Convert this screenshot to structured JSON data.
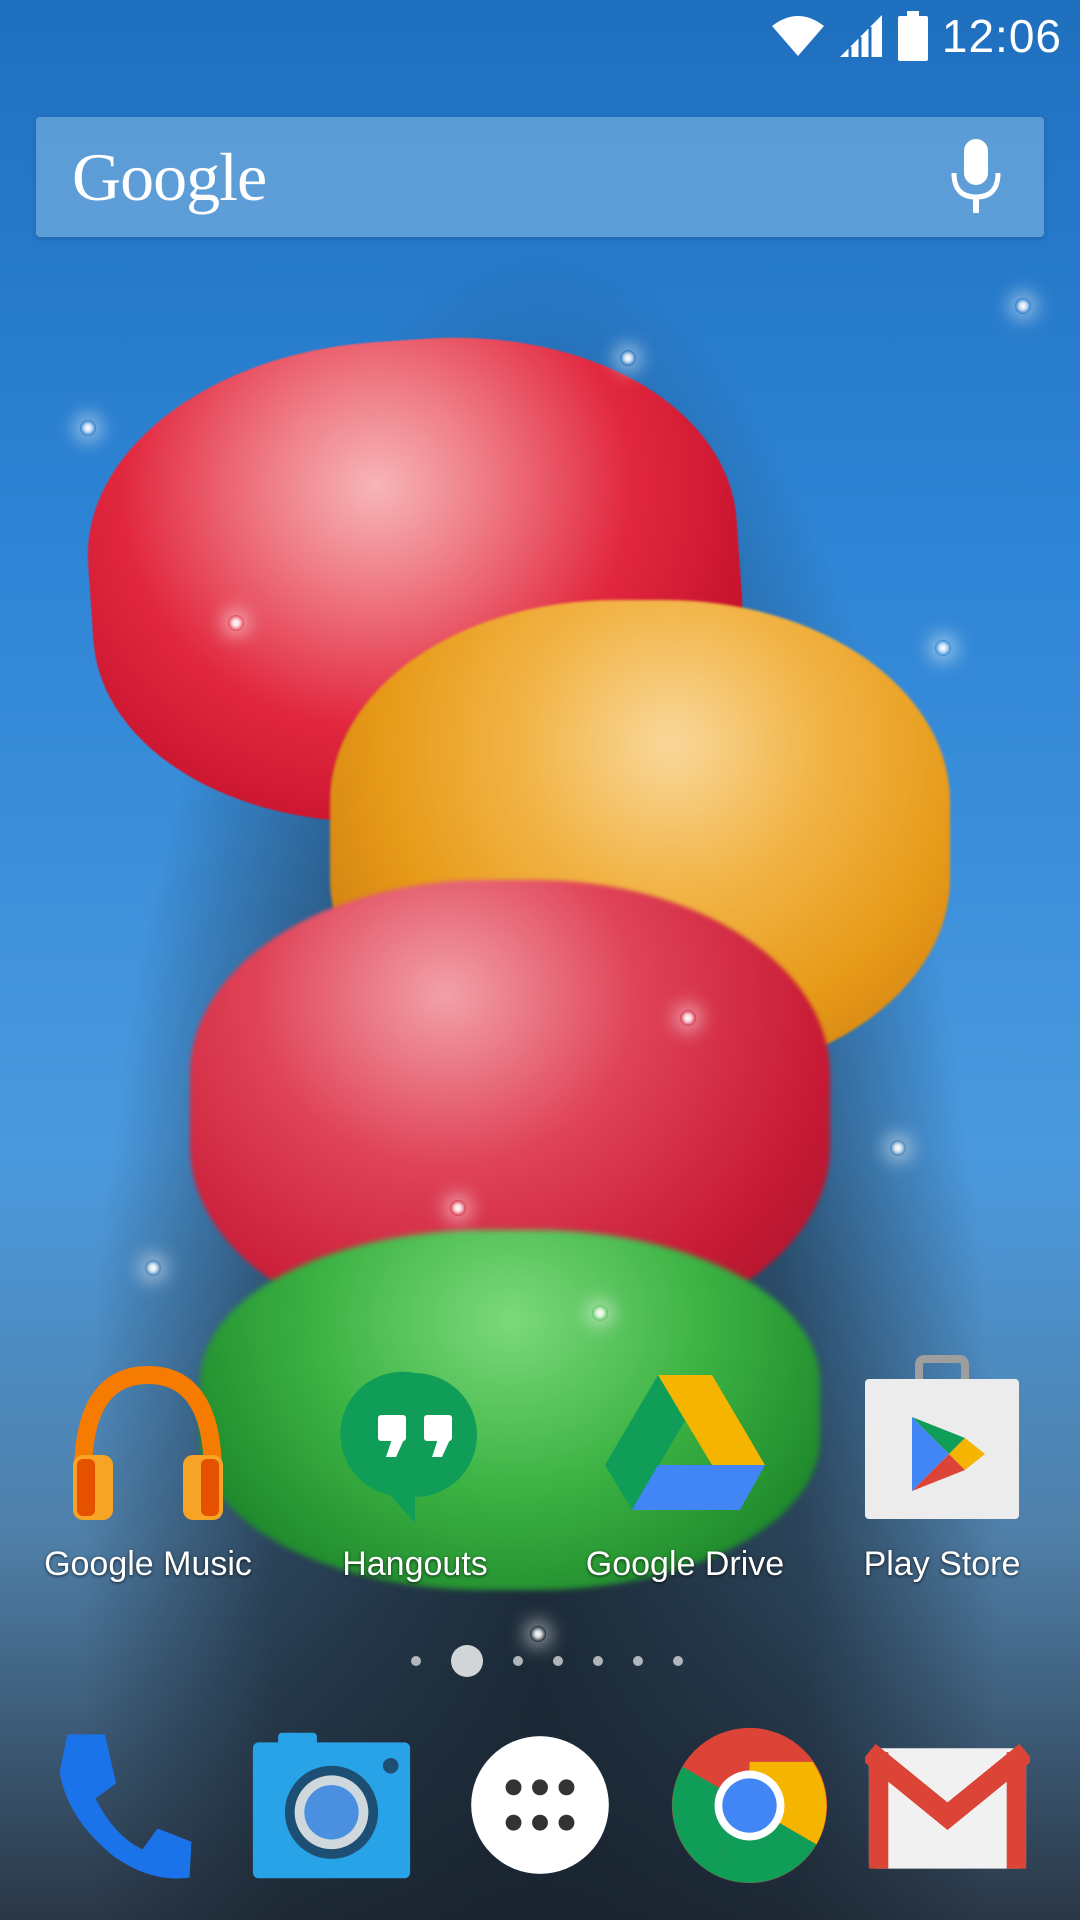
{
  "status_bar": {
    "time": "12:06",
    "icons": [
      "wifi-icon",
      "signal-icon",
      "battery-icon"
    ]
  },
  "search_bar": {
    "logo_text": "Google",
    "mic_icon": "mic-icon"
  },
  "home_apps": [
    {
      "label": "Google Music",
      "icon": "google-music-icon"
    },
    {
      "label": "Hangouts",
      "icon": "hangouts-icon"
    },
    {
      "label": "Google Drive",
      "icon": "google-drive-icon"
    },
    {
      "label": "Play Store",
      "icon": "play-store-icon"
    }
  ],
  "page_indicator": {
    "pages": 7,
    "active_index": 1
  },
  "dock": [
    {
      "icon": "phone-icon"
    },
    {
      "icon": "camera-icon"
    },
    {
      "icon": "app-drawer-icon"
    },
    {
      "icon": "chrome-icon"
    },
    {
      "icon": "gmail-icon"
    }
  ],
  "colors": {
    "google_blue": "#4285F4",
    "google_red": "#DB4437",
    "google_yellow": "#F4B400",
    "google_green": "#0F9D58",
    "music_orange": "#F57C00"
  }
}
